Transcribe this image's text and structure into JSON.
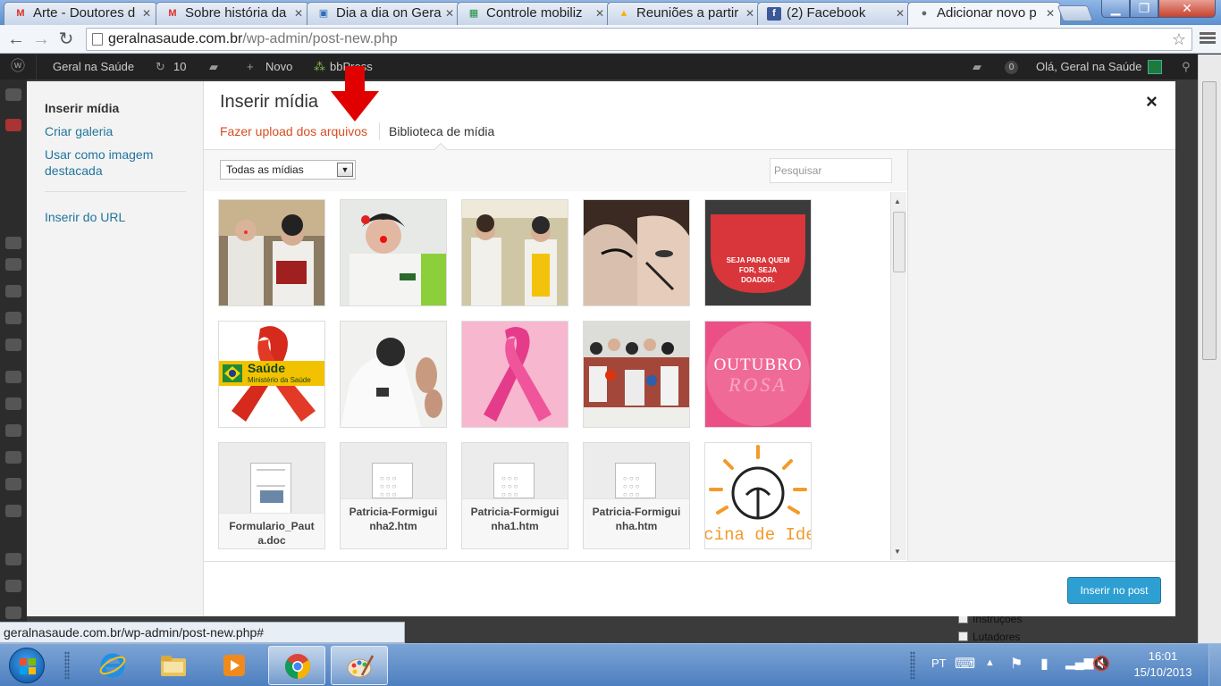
{
  "browser": {
    "tabs": [
      {
        "label": "Arte - Doutores d",
        "icon": "gmail-icon",
        "icon_glyph": "M",
        "icon_color": "#d93025"
      },
      {
        "label": "Sobre história da",
        "icon": "gmail-icon",
        "icon_glyph": "M",
        "icon_color": "#d93025"
      },
      {
        "label": "Dia a dia on Gera",
        "icon": "trello-icon",
        "icon_glyph": "▣",
        "icon_color": "#2f6fb6"
      },
      {
        "label": "Controle mobiliz",
        "icon": "sheets-icon",
        "icon_glyph": "▦",
        "icon_color": "#1e8e3e"
      },
      {
        "label": "Reuniões a partir",
        "icon": "drive-icon",
        "icon_glyph": "▲",
        "icon_color": "#f4b400"
      },
      {
        "label": "(2) Facebook",
        "icon": "facebook-icon",
        "icon_glyph": "f",
        "icon_color": "#3b5998"
      },
      {
        "label": "Adicionar novo p",
        "icon": "person-icon",
        "icon_glyph": "●",
        "icon_color": "#666666"
      }
    ],
    "url_host": "geralnasaude.com.br",
    "url_path": "/wp-admin/post-new.php",
    "status_url": "geralnasaude.com.br/wp-admin/post-new.php#"
  },
  "adminbar": {
    "site_name": "Geral na Saúde",
    "updates_count": "10",
    "new_label": "Novo",
    "bbpress_label": "bbPress",
    "notifications": "0",
    "greeting": "Olá, Geral na Saúde"
  },
  "background": {
    "checkbox_1": "Instruções",
    "checkbox_2": "Lutadores"
  },
  "media_modal": {
    "menu": {
      "insert_media": "Inserir mídia",
      "create_gallery": "Criar galeria",
      "featured_image": "Usar como imagem destacada",
      "insert_from_url": "Inserir do URL"
    },
    "title": "Inserir mídia",
    "close_glyph": "×",
    "tabs": {
      "upload": "Fazer upload dos arquivos",
      "library": "Biblioteca de mídia"
    },
    "filter": {
      "selected": "Todas as mídias",
      "search_placeholder": "Pesquisar"
    },
    "insert_button": "Inserir no post",
    "attachments": [
      {
        "type": "image",
        "name": "clowns-accordion-photo"
      },
      {
        "type": "image",
        "name": "clown-doctor-photo"
      },
      {
        "type": "image",
        "name": "clowns-hallway-photo"
      },
      {
        "type": "image",
        "name": "makeup-photo"
      },
      {
        "type": "image",
        "name": "blood-donation-graphic",
        "text": "SEJA PARA QUEM FOR, SEJA DOADOR."
      },
      {
        "type": "image",
        "name": "aids-ribbon-graphic",
        "text_1": "Saúde",
        "text_2": "Ministério da Saúde"
      },
      {
        "type": "image",
        "name": "clown-hands-photo"
      },
      {
        "type": "image",
        "name": "pink-ribbon-graphic"
      },
      {
        "type": "image",
        "name": "group-photo"
      },
      {
        "type": "image",
        "name": "outubro-rosa-graphic",
        "text_1": "OUTUBRO",
        "text_2": "ROSA"
      },
      {
        "type": "document",
        "name": "Formulario_Pauta.doc"
      },
      {
        "type": "document",
        "name": "Patricia-Formiguinha2.htm"
      },
      {
        "type": "document",
        "name": "Patricia-Formiguinha1.htm"
      },
      {
        "type": "document",
        "name": "Patricia-Formiguinha.htm"
      },
      {
        "type": "image",
        "name": "oficina-de-ideias-graphic",
        "text": "cina de Ide"
      }
    ]
  },
  "taskbar": {
    "language": "PT",
    "time": "16:01",
    "date": "15/10/2013"
  },
  "colors": {
    "wp_link": "#21759b",
    "upload_tab": "#d54e21",
    "insert_button": "#2e9fd2",
    "arrow": "#e00000"
  }
}
